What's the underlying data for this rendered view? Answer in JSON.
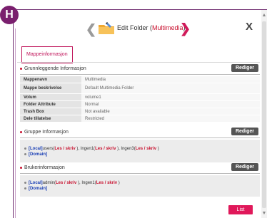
{
  "badge": "H",
  "header": {
    "title_prefix": "Edit Folder (",
    "title_name": "Multimedia",
    "title_suffix": ")",
    "close": "X"
  },
  "tab": {
    "label": "Mappeinformasjon"
  },
  "basic": {
    "title": "Grunnleggende Informasjon",
    "edit_label": "Rediger",
    "rows": [
      {
        "key": "Mappenavn",
        "value": "Multimedia"
      },
      {
        "key": "Mappe beskrivelse",
        "value": "Default Multimedia Folder"
      },
      {
        "key": "Volum",
        "value": "volume1"
      },
      {
        "key": "Folder Attribute",
        "value": "Normal"
      },
      {
        "key": "Trash Box",
        "value": "Not available"
      },
      {
        "key": "Dele tillatelse",
        "value": "Restricted"
      }
    ]
  },
  "group": {
    "title": "Gruppe Informasjon",
    "edit_label": "Rediger",
    "line1": {
      "local": "[Local]",
      "g1": "users(",
      "p1": "Les / skriv",
      "g2": " ), Ingen1(",
      "p2": "Les / skriv",
      "g3": " ), Ingen3(",
      "p3": "Les / skriv",
      "end": " )"
    },
    "line2": "[Domain]"
  },
  "user": {
    "title": "Brukerinformasjon",
    "edit_label": "Rediger",
    "line1": {
      "local": "[Local]",
      "u1": "admin(",
      "p1": "Les / skriv",
      "u2": " ), Ingen1(",
      "p2": "Les / skriv",
      "end": " )"
    },
    "line2": "[Domain]"
  },
  "footer": {
    "list_label": "List"
  },
  "colors": {
    "accent": "#c8102e",
    "brand": "#7a1f6e",
    "button": "#e0185a"
  }
}
